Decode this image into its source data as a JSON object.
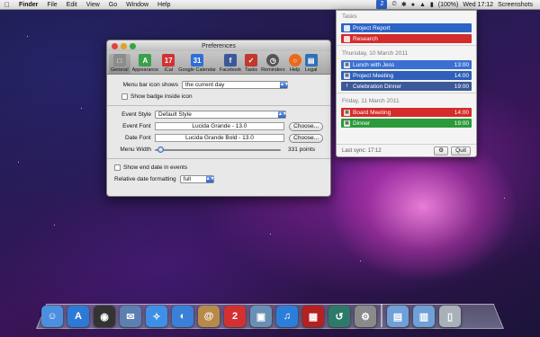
{
  "menubar": {
    "app_name": "Finder",
    "items": [
      "File",
      "Edit",
      "View",
      "Go",
      "Window",
      "Help"
    ],
    "status_badge": "2",
    "battery": "(100%)",
    "clock": "Wed 17:12",
    "right_label": "Screenshots"
  },
  "prefs": {
    "title": "Preferences",
    "toolbar": [
      {
        "label": "General",
        "icon": "general-icon",
        "color": "#8c8c8c"
      },
      {
        "label": "Appearance",
        "icon": "appearance-icon",
        "color": "#3aa04a"
      },
      {
        "label": "iCal",
        "icon": "ical-icon",
        "color": "#d33131"
      },
      {
        "label": "Google Calendar",
        "icon": "google-calendar-icon",
        "color": "#2d6fd6"
      },
      {
        "label": "Facebook",
        "icon": "facebook-icon",
        "color": "#3b5998"
      },
      {
        "label": "Tasks",
        "icon": "tasks-icon",
        "color": "#c0392b"
      },
      {
        "label": "Reminders",
        "icon": "reminders-icon",
        "color": "#555555"
      },
      {
        "label": "Help",
        "icon": "help-icon",
        "color": "#e86a1c"
      },
      {
        "label": "Legal",
        "icon": "legal-icon",
        "color": "#2f6fb6"
      }
    ],
    "menubar_icon_label": "Menu bar icon shows",
    "menubar_icon_value": "the current day",
    "show_badge_label": "Show badge inside icon",
    "event_style_label": "Event Style",
    "event_style_value": "Default Style",
    "event_font_label": "Event Font",
    "event_font_value": "Lucida Grande - 13.0",
    "date_font_label": "Date Font",
    "date_font_value": "Lucida Grande Bold - 13.0",
    "choose_label": "Choose...",
    "menu_width_label": "Menu Width",
    "menu_width_value": "331 points",
    "show_end_date_label": "Show end date in events",
    "relative_date_label": "Relative date formatting",
    "relative_date_value": "full"
  },
  "popup": {
    "tasks_heading": "Tasks",
    "tasks": [
      {
        "title": "Project Report",
        "color": "#2c63c7"
      },
      {
        "title": "Research",
        "color": "#d42b2b"
      }
    ],
    "day1_heading": "Thursday, 10 March 2011",
    "day1": [
      {
        "title": "Lunch with Jess",
        "time": "13:00",
        "color": "#3b6fd2",
        "icon": "calendar-icon"
      },
      {
        "title": "Project Meeting",
        "time": "14:00",
        "color": "#2f5fb8",
        "icon": "calendar-icon"
      },
      {
        "title": "Celebration Dinner",
        "time": "19:00",
        "color": "#3b5998",
        "icon": "facebook-icon"
      }
    ],
    "day2_heading": "Friday, 11 March 2011",
    "day2": [
      {
        "title": "Board Meeting",
        "time": "14:00",
        "color": "#d42b2b",
        "icon": "calendar-icon"
      },
      {
        "title": "Dinner",
        "time": "19:00",
        "color": "#2a9a3a",
        "icon": "calendar-icon"
      }
    ],
    "last_sync": "Last sync: 17:12",
    "quit_label": "Quit"
  },
  "dock": [
    {
      "name": "finder-icon",
      "color": "#4a8fe0"
    },
    {
      "name": "app-store-icon",
      "color": "#2d7ad6"
    },
    {
      "name": "dashboard-icon",
      "color": "#333333"
    },
    {
      "name": "mail-icon",
      "color": "#5a7fb0"
    },
    {
      "name": "safari-icon",
      "color": "#3f8fe6"
    },
    {
      "name": "ichat-icon",
      "color": "#3a80d8"
    },
    {
      "name": "address-book-icon",
      "color": "#b88a4a"
    },
    {
      "name": "ical-icon",
      "color": "#d33131"
    },
    {
      "name": "iphoto-icon",
      "color": "#6a8fb5"
    },
    {
      "name": "itunes-icon",
      "color": "#2c7fd8"
    },
    {
      "name": "photo-booth-icon",
      "color": "#b52020"
    },
    {
      "name": "time-machine-icon",
      "color": "#2d7a6a"
    },
    {
      "name": "system-preferences-icon",
      "color": "#8a8a8a"
    },
    {
      "name": "applications-folder-icon",
      "color": "#6fa0d8"
    },
    {
      "name": "documents-folder-icon",
      "color": "#6fa0d8"
    },
    {
      "name": "trash-icon",
      "color": "#a8b0b8"
    }
  ]
}
